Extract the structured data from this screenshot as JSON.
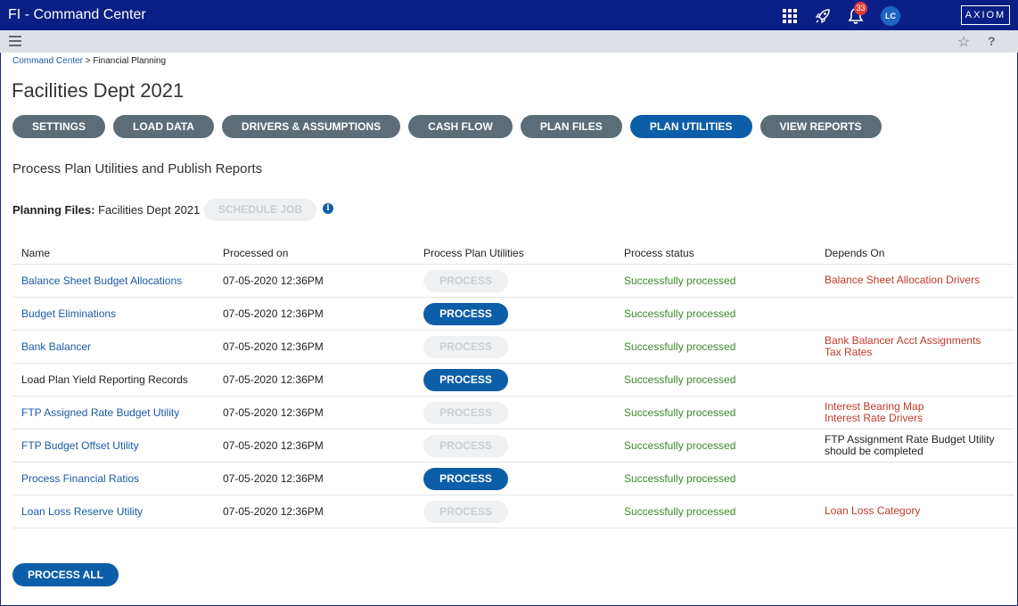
{
  "app": {
    "title": "FI - Command Center",
    "notification_count": "33",
    "avatar_initials": "LC",
    "logo_text": "AXIOM"
  },
  "breadcrumb": {
    "parent": "Command Center",
    "separator": ">",
    "current": "Financial Planning"
  },
  "page": {
    "title": "Facilities Dept 2021",
    "section_title": "Process Plan Utilities and Publish Reports"
  },
  "tabs": [
    {
      "label": "SETTINGS",
      "active": false
    },
    {
      "label": "LOAD DATA",
      "active": false
    },
    {
      "label": "DRIVERS & ASSUMPTIONS",
      "active": false
    },
    {
      "label": "CASH FLOW",
      "active": false
    },
    {
      "label": "PLAN FILES",
      "active": false
    },
    {
      "label": "PLAN UTILITIES",
      "active": true
    },
    {
      "label": "VIEW REPORTS",
      "active": false
    }
  ],
  "planning": {
    "label": "Planning Files:",
    "value": "Facilities Dept 2021",
    "schedule_label": "SCHEDULE JOB"
  },
  "table": {
    "headers": {
      "name": "Name",
      "processed_on": "Processed on",
      "process": "Process Plan Utilities",
      "status": "Process status",
      "depends": "Depends On"
    },
    "rows": [
      {
        "name": "Balance Sheet Budget Allocations",
        "link": true,
        "date": "07-05-2020 12:36PM",
        "button": "PROCESS",
        "enabled": false,
        "status": "Successfully processed",
        "depends": [
          "Balance Sheet Allocation Drivers"
        ],
        "depends_is_note": false
      },
      {
        "name": "Budget Eliminations",
        "link": true,
        "date": "07-05-2020 12:36PM",
        "button": "PROCESS",
        "enabled": true,
        "status": "Successfully processed",
        "depends": [],
        "depends_is_note": false
      },
      {
        "name": "Bank Balancer",
        "link": true,
        "date": "07-05-2020 12:36PM",
        "button": "PROCESS",
        "enabled": false,
        "status": "Successfully processed",
        "depends": [
          "Bank Balancer Acct Assignments",
          "Tax Rates"
        ],
        "depends_is_note": false
      },
      {
        "name": "Load Plan Yield Reporting Records",
        "link": false,
        "date": "07-05-2020 12:36PM",
        "button": "PROCESS",
        "enabled": true,
        "status": "Successfully processed",
        "depends": [],
        "depends_is_note": false
      },
      {
        "name": "FTP Assigned Rate Budget Utility",
        "link": true,
        "date": "07-05-2020 12:36PM",
        "button": "PROCESS",
        "enabled": false,
        "status": "Successfully processed",
        "depends": [
          "Interest Bearing Map",
          "Interest Rate Drivers"
        ],
        "depends_is_note": false
      },
      {
        "name": "FTP Budget Offset Utility",
        "link": true,
        "date": "07-05-2020 12:36PM",
        "button": "PROCESS",
        "enabled": false,
        "status": "Successfully processed",
        "depends": [
          "FTP Assignment Rate Budget Utility",
          "should be completed"
        ],
        "depends_is_note": true
      },
      {
        "name": "Process Financial Ratios",
        "link": true,
        "date": "07-05-2020 12:36PM",
        "button": "PROCESS",
        "enabled": true,
        "status": "Successfully processed",
        "depends": [],
        "depends_is_note": false
      },
      {
        "name": "Loan Loss Reserve Utility",
        "link": true,
        "date": "07-05-2020 12:36PM",
        "button": "PROCESS",
        "enabled": false,
        "status": "Successfully processed",
        "depends": [
          "Loan Loss Category"
        ],
        "depends_is_note": false
      }
    ]
  },
  "actions": {
    "process_all_label": "PROCESS ALL"
  },
  "icons": {
    "apps": "apps-grid-icon",
    "rocket": "rocket-icon",
    "bell": "bell-icon",
    "menu": "hamburger-menu-icon",
    "star": "star-icon",
    "help": "help-icon",
    "info": "info-icon"
  },
  "colors": {
    "topbar": "#0a1f85",
    "primary": "#0c5ea8",
    "tab_inactive": "#5d6d77",
    "link": "#1b5aa5",
    "success": "#3a8a2a",
    "dependency": "#c0392b",
    "badge": "#e23b3b"
  }
}
